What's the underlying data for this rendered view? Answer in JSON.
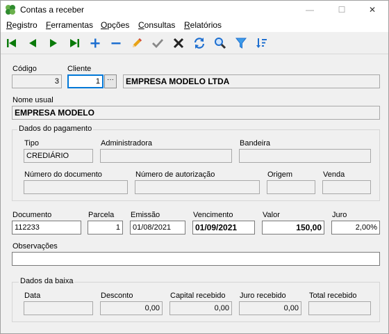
{
  "window": {
    "title": "Contas a receber",
    "minimize": "—",
    "maximize": "☐",
    "close": "✕"
  },
  "menu": {
    "registro": {
      "accel": "R",
      "rest": "egistro"
    },
    "ferramentas": {
      "accel": "F",
      "rest": "erramentas"
    },
    "opcoes": {
      "accel": "O",
      "rest": "pções"
    },
    "consultas": {
      "accel": "C",
      "rest": "onsultas"
    },
    "relatorios": {
      "accel": "R",
      "rest": "elatórios"
    }
  },
  "toolbar": {
    "icons": [
      "first-record-icon",
      "previous-record-icon",
      "next-record-icon",
      "last-record-icon",
      "add-icon",
      "remove-icon",
      "edit-icon",
      "confirm-icon",
      "cancel-icon",
      "refresh-icon",
      "search-icon",
      "filter-icon",
      "sort-icon"
    ]
  },
  "form": {
    "codigo": {
      "label": "Código",
      "value": "3"
    },
    "cliente": {
      "label": "Cliente",
      "value": "1",
      "name": "EMPRESA MODELO LTDA",
      "browse": "···"
    },
    "nome_usual": {
      "label": "Nome usual",
      "value": "EMPRESA MODELO"
    },
    "pagamento": {
      "title": "Dados do pagamento",
      "tipo": {
        "label": "Tipo",
        "value": "CREDIÁRIO"
      },
      "administradora": {
        "label": "Administradora",
        "value": ""
      },
      "bandeira": {
        "label": "Bandeira",
        "value": ""
      },
      "numero_documento": {
        "label": "Número do documento",
        "value": ""
      },
      "numero_autorizacao": {
        "label": "Número de autorização",
        "value": ""
      },
      "origem": {
        "label": "Origem",
        "value": ""
      },
      "venda": {
        "label": "Venda",
        "value": ""
      }
    },
    "documento": {
      "label": "Documento",
      "value": "112233"
    },
    "parcela": {
      "label": "Parcela",
      "value": "1"
    },
    "emissao": {
      "label": "Emissão",
      "value": "01/08/2021"
    },
    "vencimento": {
      "label": "Vencimento",
      "value": "01/09/2021"
    },
    "valor": {
      "label": "Valor",
      "value": "150,00"
    },
    "juro": {
      "label": "Juro",
      "value": "2,00%"
    },
    "observacoes": {
      "label": "Observações",
      "value": ""
    },
    "baixa": {
      "title": "Dados da baixa",
      "data": {
        "label": "Data",
        "value": ""
      },
      "desconto": {
        "label": "Desconto",
        "value": "0,00"
      },
      "capital": {
        "label": "Capital recebido",
        "value": "0,00"
      },
      "juro_recebido": {
        "label": "Juro recebido",
        "value": "0,00"
      },
      "total": {
        "label": "Total recebido",
        "value": ""
      }
    }
  },
  "colors": {
    "accent": "#0a7a0a",
    "blue": "#1e6fd0",
    "dark": "#222222"
  }
}
